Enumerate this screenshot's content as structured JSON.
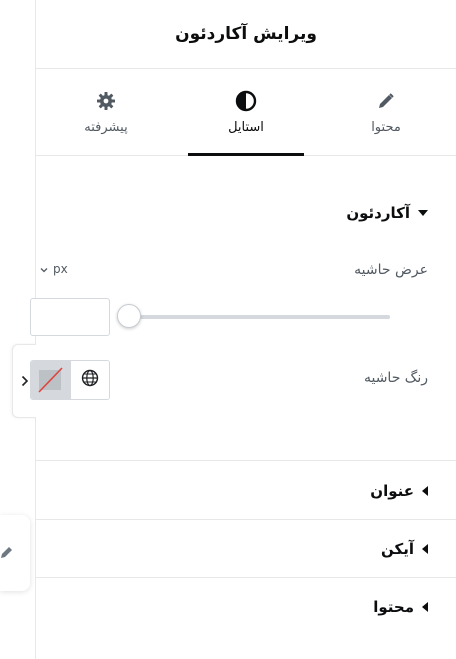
{
  "header": {
    "title": "ویرایش آکاردئون"
  },
  "tabs": [
    {
      "label": "محتوا",
      "icon": "pencil-icon",
      "active": false
    },
    {
      "label": "استایل",
      "icon": "contrast-icon",
      "active": true
    },
    {
      "label": "پیشرفته",
      "icon": "gear-icon",
      "active": false
    }
  ],
  "accordion_section": {
    "title": "آکاردئون",
    "border_width_label": "عرض حاشیه",
    "unit": "px",
    "border_width_value": "",
    "border_color_label": "رنگ حاشیه"
  },
  "collapsed_sections": [
    {
      "title": "عنوان"
    },
    {
      "title": "آیکن"
    },
    {
      "title": "محتوا"
    }
  ],
  "colors": {
    "accent": "#0c0d0e",
    "border": "#e6e8ea",
    "muted": "#515962",
    "clear_line": "#e0443e"
  }
}
